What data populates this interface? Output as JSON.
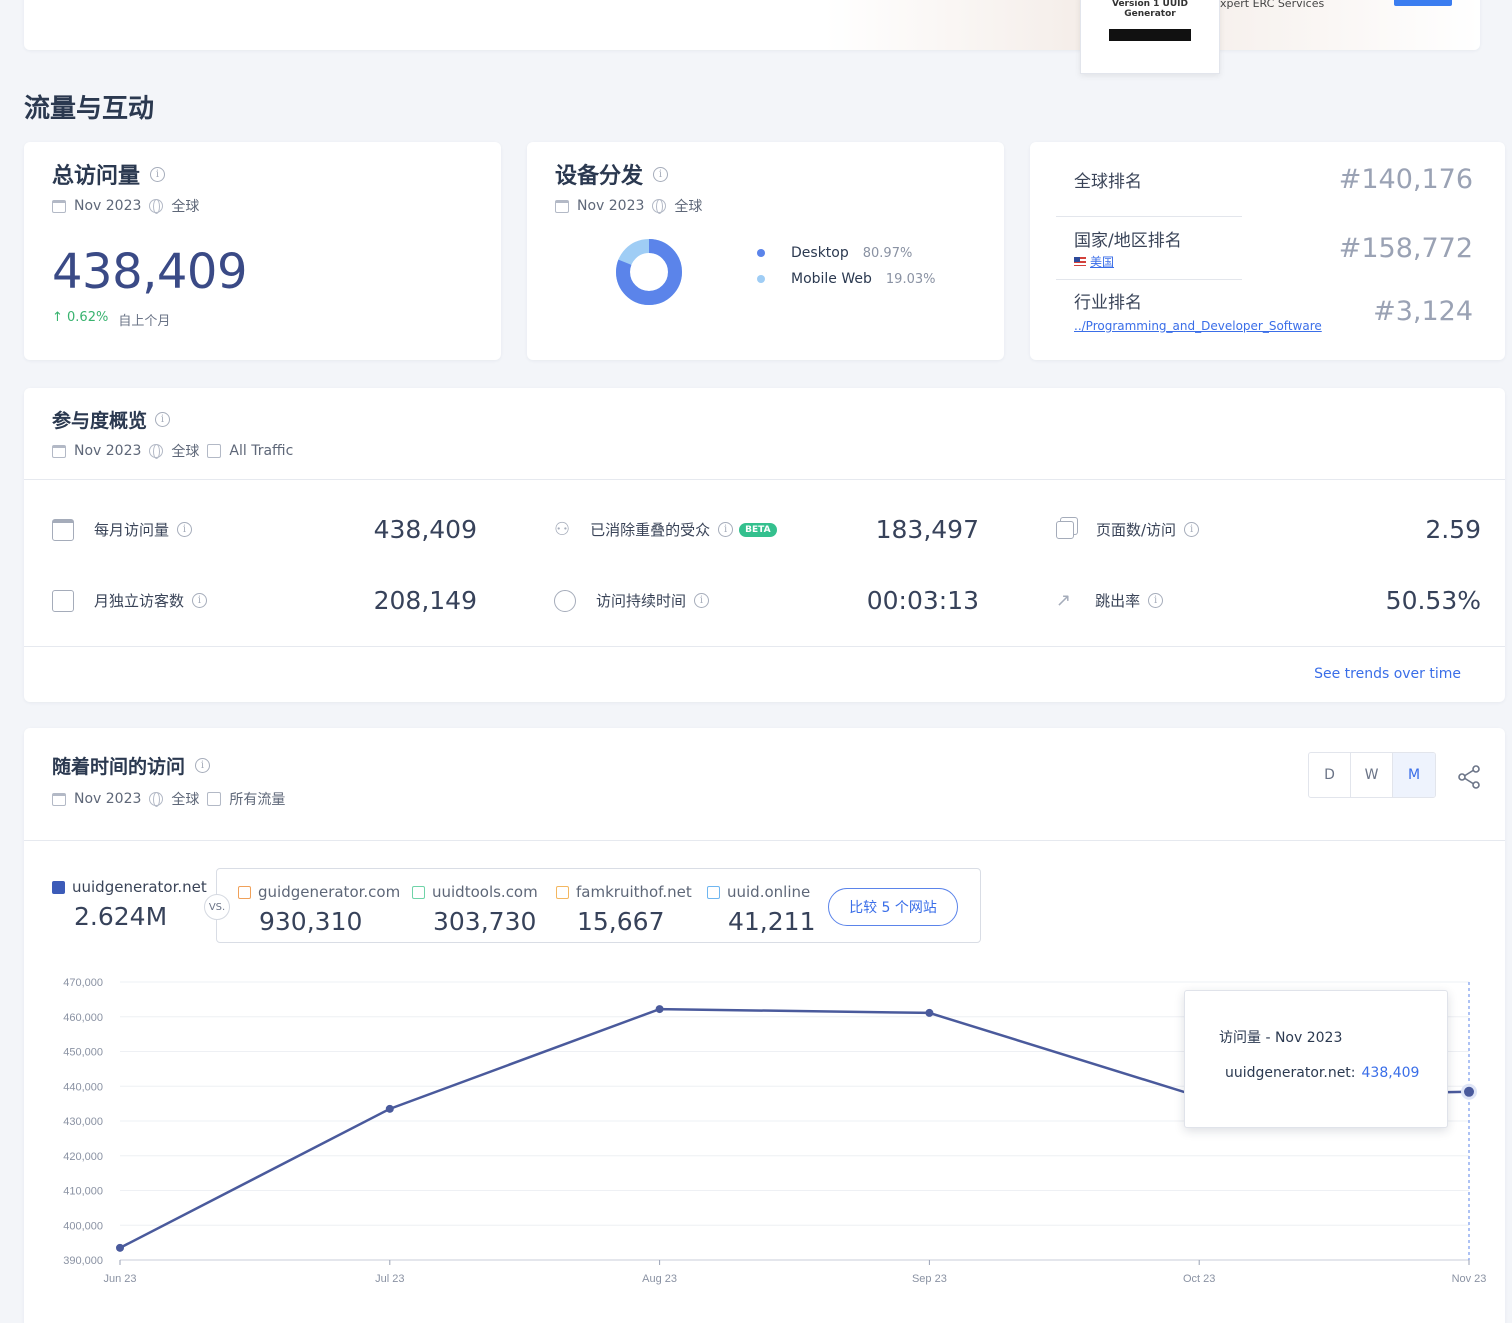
{
  "banner": {
    "ad_title": "Version 1 UUID Generator",
    "ad_text": "xpert ERC Services"
  },
  "section_title": "流量与互动",
  "total_visits": {
    "title": "总访问量",
    "date": "Nov 2023",
    "region": "全球",
    "value": "438,409",
    "change": "0.62%",
    "change_label": "自上个月"
  },
  "device": {
    "title": "设备分发",
    "date": "Nov 2023",
    "region": "全球",
    "items": [
      {
        "label": "Desktop",
        "value": "80.97%",
        "color": "#5b84ea",
        "share": 80.97
      },
      {
        "label": "Mobile Web",
        "value": "19.03%",
        "color": "#9fcdf5",
        "share": 19.03
      }
    ]
  },
  "ranks": {
    "global_label": "全球排名",
    "global_value": "#140,176",
    "country_label": "国家/地区排名",
    "country_link": "美国",
    "country_value": "#158,772",
    "industry_label": "行业排名",
    "industry_link": "../Programming_and_Developer_Software",
    "industry_value": "#3,124"
  },
  "engagement": {
    "title": "参与度概览",
    "date": "Nov 2023",
    "region": "全球",
    "traffic": "All Traffic",
    "metrics": [
      {
        "label": "每月访问量",
        "value": "438,409",
        "icon": "calendar-icon"
      },
      {
        "label": "已消除重叠的受众",
        "value": "183,497",
        "icon": "users-icon",
        "badge": "BETA"
      },
      {
        "label": "页面数/访问",
        "value": "2.59",
        "icon": "pages-icon"
      },
      {
        "label": "月独立访客数",
        "value": "208,149",
        "icon": "visitor-icon"
      },
      {
        "label": "访问持续时间",
        "value": "00:03:13",
        "icon": "timer-icon"
      },
      {
        "label": "跳出率",
        "value": "50.53%",
        "icon": "bounce-icon"
      }
    ],
    "trends_link": "See trends over time"
  },
  "visits_over_time": {
    "title": "随着时间的访问",
    "date": "Nov 2023",
    "region": "全球",
    "traffic": "所有流量",
    "granularity": [
      "D",
      "W",
      "M"
    ],
    "active_granularity": "M",
    "main_site": {
      "name": "uuidgenerator.net",
      "value": "2.624M"
    },
    "vs": "VS.",
    "competitors": [
      {
        "name": "guidgenerator.com",
        "value": "930,310",
        "color": "#f0a15a"
      },
      {
        "name": "uuidtools.com",
        "value": "303,730",
        "color": "#6fd3a8"
      },
      {
        "name": "famkruithof.net",
        "value": "15,667",
        "color": "#f3b760"
      },
      {
        "name": "uuid.online",
        "value": "41,211",
        "color": "#6fb6f0"
      }
    ],
    "compare_button": "比较 5 个网站",
    "tooltip": {
      "title": "访问量 - Nov 2023",
      "site": "uuidgenerator.net:",
      "value": "438,409"
    }
  },
  "chart_data": {
    "type": "line",
    "categories": [
      "Jun 23",
      "Jul 23",
      "Aug 23",
      "Sep 23",
      "Oct 23",
      "Nov 23"
    ],
    "series": [
      {
        "name": "uuidgenerator.net",
        "values": [
          393500,
          433500,
          462200,
          461100,
          437000,
          438409
        ]
      }
    ],
    "yticks": [
      "390,000",
      "400,000",
      "410,000",
      "420,000",
      "430,000",
      "440,000",
      "450,000",
      "460,000",
      "470,000"
    ],
    "ylim": [
      390000,
      470000
    ],
    "line_color": "#4a5a9c"
  }
}
